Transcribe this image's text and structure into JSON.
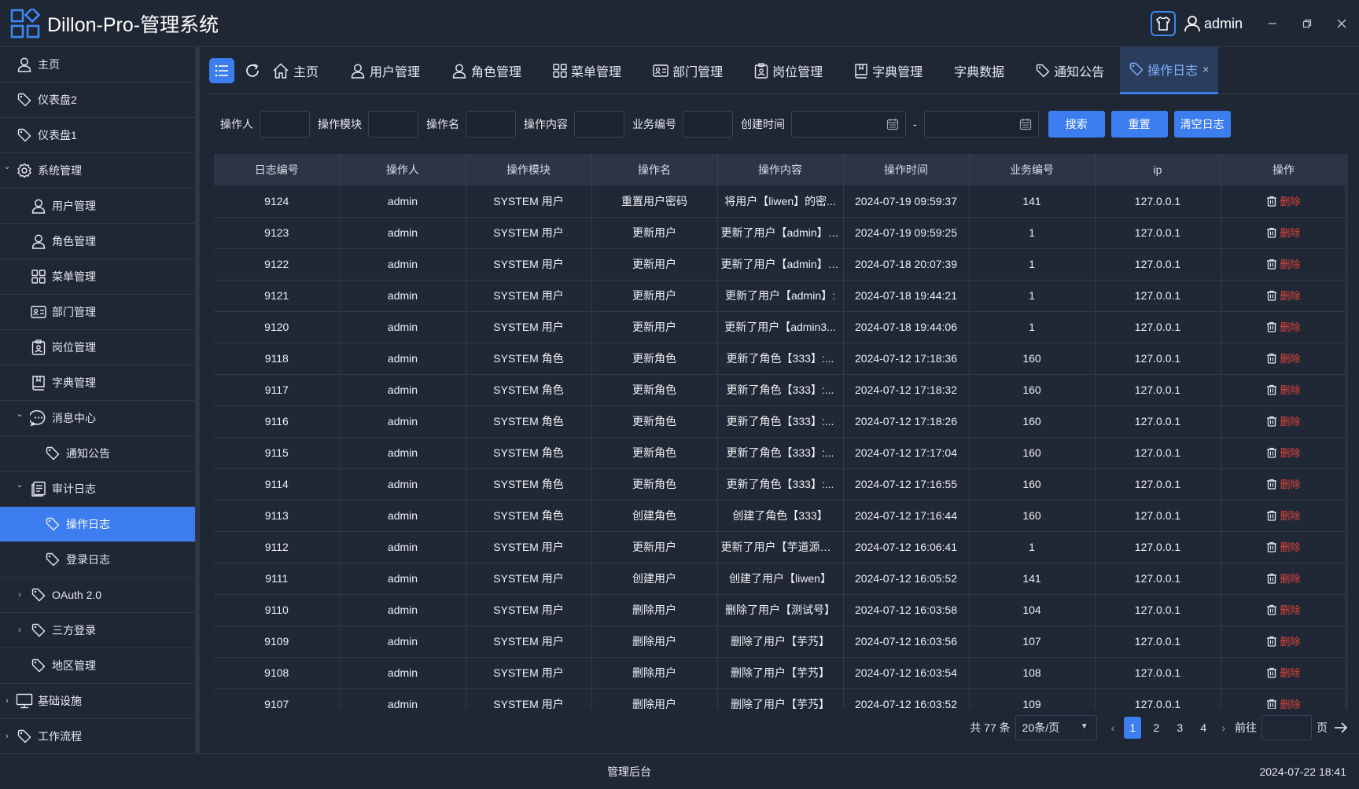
{
  "app": {
    "title": "Dillon-Pro-管理系统",
    "user": "admin"
  },
  "colors": {
    "accent": "#3c7ef0",
    "danger": "#e0453a",
    "background": "#1f2634"
  },
  "sidebar": {
    "items": [
      {
        "label": "主页",
        "icon": "user-icon"
      },
      {
        "label": "仪表盘2",
        "icon": "tag-icon"
      },
      {
        "label": "仪表盘1",
        "icon": "tag-icon"
      },
      {
        "label": "系统管理",
        "icon": "gear-icon"
      },
      {
        "label": "用户管理",
        "icon": "user-icon"
      },
      {
        "label": "角色管理",
        "icon": "user-icon"
      },
      {
        "label": "菜单管理",
        "icon": "grid-icon"
      },
      {
        "label": "部门管理",
        "icon": "id-card-icon"
      },
      {
        "label": "岗位管理",
        "icon": "badge-icon"
      },
      {
        "label": "字典管理",
        "icon": "book-icon"
      },
      {
        "label": "消息中心",
        "icon": "chat-icon"
      },
      {
        "label": "通知公告",
        "icon": "tag-icon"
      },
      {
        "label": "审计日志",
        "icon": "document-icon"
      },
      {
        "label": "操作日志",
        "icon": "tag-icon"
      },
      {
        "label": "登录日志",
        "icon": "tag-icon"
      },
      {
        "label": "OAuth 2.0",
        "icon": "tag-icon"
      },
      {
        "label": "三方登录",
        "icon": "tag-icon"
      },
      {
        "label": "地区管理",
        "icon": "tag-icon"
      },
      {
        "label": "基础设施",
        "icon": "monitor-icon"
      },
      {
        "label": "工作流程",
        "icon": "tag-icon"
      }
    ]
  },
  "tabs": {
    "items": [
      {
        "label": "主页",
        "icon": "home-icon"
      },
      {
        "label": "用户管理",
        "icon": "user-icon"
      },
      {
        "label": "角色管理",
        "icon": "user-icon"
      },
      {
        "label": "菜单管理",
        "icon": "grid-icon"
      },
      {
        "label": "部门管理",
        "icon": "id-card-icon"
      },
      {
        "label": "岗位管理",
        "icon": "badge-icon"
      },
      {
        "label": "字典管理",
        "icon": "book-icon"
      },
      {
        "label": "字典数据",
        "icon": ""
      },
      {
        "label": "通知公告",
        "icon": "tag-icon"
      },
      {
        "label": "操作日志",
        "icon": "tag-icon"
      }
    ]
  },
  "search": {
    "labels": {
      "operator": "操作人",
      "module": "操作模块",
      "name": "操作名",
      "content": "操作内容",
      "biz_no": "业务编号",
      "create_time": "创建时间"
    },
    "range_separator": "-",
    "buttons": {
      "search": "搜索",
      "reset": "重置",
      "clear": "清空日志"
    }
  },
  "table": {
    "columns": [
      "日志编号",
      "操作人",
      "操作模块",
      "操作名",
      "操作内容",
      "操作时间",
      "业务编号",
      "ip",
      "操作"
    ],
    "delete_label": "删除",
    "rows": [
      [
        "9124",
        "admin",
        "SYSTEM 用户",
        "重置用户密码",
        "将用户【liwen】的密...",
        "2024-07-19 09:59:37",
        "141",
        "127.0.0.1"
      ],
      [
        "9123",
        "admin",
        "SYSTEM 用户",
        "更新用户",
        "更新了用户【admin】:...",
        "2024-07-19 09:59:25",
        "1",
        "127.0.0.1"
      ],
      [
        "9122",
        "admin",
        "SYSTEM 用户",
        "更新用户",
        "更新了用户【admin】:...",
        "2024-07-18 20:07:39",
        "1",
        "127.0.0.1"
      ],
      [
        "9121",
        "admin",
        "SYSTEM 用户",
        "更新用户",
        "更新了用户【admin】:",
        "2024-07-18 19:44:21",
        "1",
        "127.0.0.1"
      ],
      [
        "9120",
        "admin",
        "SYSTEM 用户",
        "更新用户",
        "更新了用户【admin3...",
        "2024-07-18 19:44:06",
        "1",
        "127.0.0.1"
      ],
      [
        "9118",
        "admin",
        "SYSTEM 角色",
        "更新角色",
        "更新了角色【333】:...",
        "2024-07-12 17:18:36",
        "160",
        "127.0.0.1"
      ],
      [
        "9117",
        "admin",
        "SYSTEM 角色",
        "更新角色",
        "更新了角色【333】:...",
        "2024-07-12 17:18:32",
        "160",
        "127.0.0.1"
      ],
      [
        "9116",
        "admin",
        "SYSTEM 角色",
        "更新角色",
        "更新了角色【333】:...",
        "2024-07-12 17:18:26",
        "160",
        "127.0.0.1"
      ],
      [
        "9115",
        "admin",
        "SYSTEM 角色",
        "更新角色",
        "更新了角色【333】:...",
        "2024-07-12 17:17:04",
        "160",
        "127.0.0.1"
      ],
      [
        "9114",
        "admin",
        "SYSTEM 角色",
        "更新角色",
        "更新了角色【333】:...",
        "2024-07-12 17:16:55",
        "160",
        "127.0.0.1"
      ],
      [
        "9113",
        "admin",
        "SYSTEM 角色",
        "创建角色",
        "创建了角色【333】",
        "2024-07-12 17:16:44",
        "160",
        "127.0.0.1"
      ],
      [
        "9112",
        "admin",
        "SYSTEM 用户",
        "更新用户",
        "更新了用户【芋道源码...",
        "2024-07-12 16:06:41",
        "1",
        "127.0.0.1"
      ],
      [
        "9111",
        "admin",
        "SYSTEM 用户",
        "创建用户",
        "创建了用户【liwen】",
        "2024-07-12 16:05:52",
        "141",
        "127.0.0.1"
      ],
      [
        "9110",
        "admin",
        "SYSTEM 用户",
        "删除用户",
        "删除了用户【测试号】",
        "2024-07-12 16:03:58",
        "104",
        "127.0.0.1"
      ],
      [
        "9109",
        "admin",
        "SYSTEM 用户",
        "删除用户",
        "删除了用户【芋艿】",
        "2024-07-12 16:03:56",
        "107",
        "127.0.0.1"
      ],
      [
        "9108",
        "admin",
        "SYSTEM 用户",
        "删除用户",
        "删除了用户【芋艿】",
        "2024-07-12 16:03:54",
        "108",
        "127.0.0.1"
      ],
      [
        "9107",
        "admin",
        "SYSTEM 用户",
        "删除用户",
        "删除了用户【芋艿】",
        "2024-07-12 16:03:52",
        "109",
        "127.0.0.1"
      ]
    ]
  },
  "pagination": {
    "total": "共 77 条",
    "page_size": "20条/页",
    "pages": [
      "1",
      "2",
      "3",
      "4"
    ],
    "current": "1",
    "goto_label": "前往",
    "page_suffix": "页"
  },
  "footer": {
    "center": "管理后台",
    "time": "2024-07-22 18:41"
  }
}
